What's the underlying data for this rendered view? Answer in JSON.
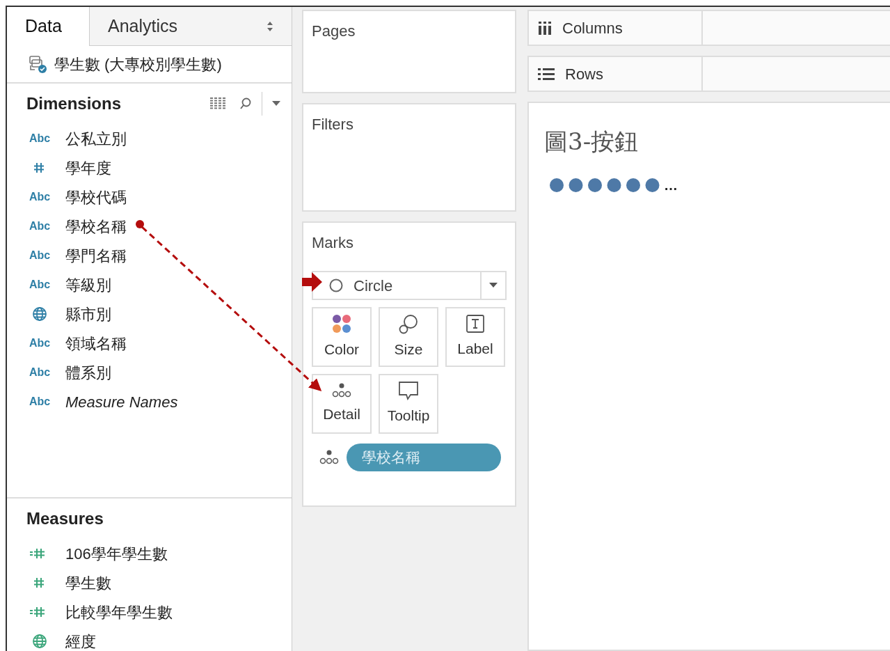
{
  "tabs": [
    {
      "label": "Data",
      "selected": true
    },
    {
      "label": "Analytics",
      "selected": false
    }
  ],
  "data_source": {
    "name": "學生數 (大專校別學生數)"
  },
  "dimensions": {
    "title": "Dimensions",
    "items": [
      {
        "kind": "string",
        "type_label": "Abc",
        "name": "公私立別",
        "italic": false
      },
      {
        "kind": "number",
        "name": "學年度",
        "italic": false
      },
      {
        "kind": "string",
        "type_label": "Abc",
        "name": "學校代碼",
        "italic": false
      },
      {
        "kind": "string",
        "type_label": "Abc",
        "name": "學校名稱",
        "italic": false
      },
      {
        "kind": "string",
        "type_label": "Abc",
        "name": "學門名稱",
        "italic": false
      },
      {
        "kind": "string",
        "type_label": "Abc",
        "name": "等級別",
        "italic": false
      },
      {
        "kind": "geo",
        "name": "縣市別",
        "italic": false
      },
      {
        "kind": "string",
        "type_label": "Abc",
        "name": "領域名稱",
        "italic": false
      },
      {
        "kind": "string",
        "type_label": "Abc",
        "name": "體系別",
        "italic": false
      },
      {
        "kind": "string",
        "type_label": "Abc",
        "name": "Measure Names",
        "italic": true
      }
    ]
  },
  "measures": {
    "title": "Measures",
    "items": [
      {
        "kind": "calc_number",
        "name": "106學年學生數"
      },
      {
        "kind": "number",
        "name": "學生數"
      },
      {
        "kind": "calc_number",
        "name": "比較學年學生數"
      },
      {
        "kind": "geo",
        "name": "經度"
      }
    ]
  },
  "pages": {
    "title": "Pages"
  },
  "filters": {
    "title": "Filters"
  },
  "marks": {
    "title": "Marks",
    "mark_type": "Circle",
    "cards": [
      {
        "kind": "color",
        "label": "Color"
      },
      {
        "kind": "size",
        "label": "Size"
      },
      {
        "kind": "label",
        "label": "Label"
      },
      {
        "kind": "detail",
        "label": "Detail"
      },
      {
        "kind": "tooltip",
        "label": "Tooltip"
      }
    ],
    "pills": [
      {
        "kind": "detail",
        "label": "學校名稱"
      }
    ]
  },
  "shelves": [
    {
      "kind": "columns",
      "label": "Columns"
    },
    {
      "kind": "rows",
      "label": "Rows"
    }
  ],
  "view": {
    "title": "圖3-按鈕",
    "ellipsis": "…"
  }
}
